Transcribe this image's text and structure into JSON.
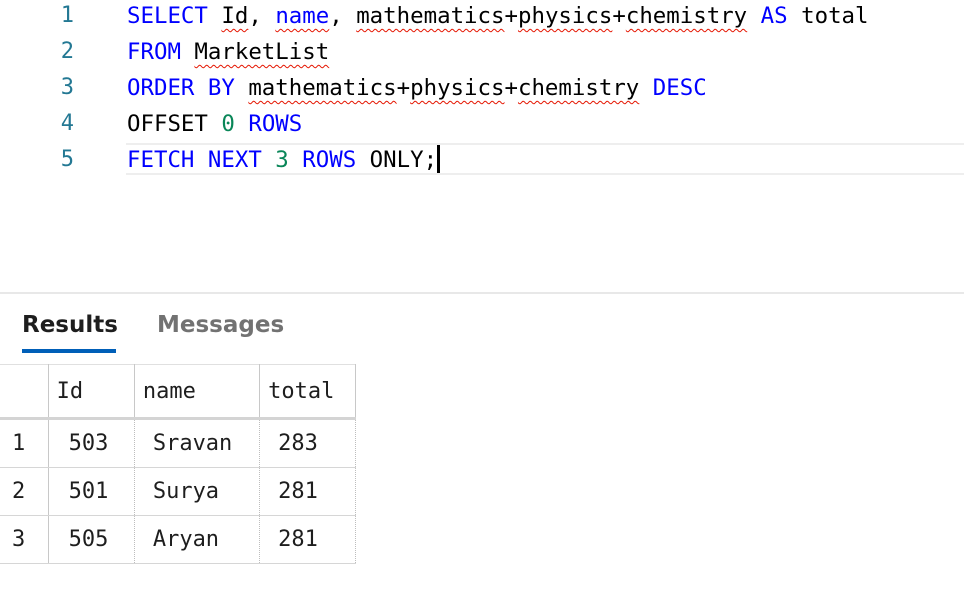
{
  "editor": {
    "lines": [
      {
        "number": "1"
      },
      {
        "number": "2"
      },
      {
        "number": "3"
      },
      {
        "number": "4"
      },
      {
        "number": "5"
      }
    ],
    "tokens": {
      "select": "SELECT",
      "id": "Id",
      "comma1": ",",
      "name": "name",
      "comma2": ",",
      "mathematics": "mathematics",
      "plus1": "+",
      "physics": "physics",
      "plus2": "+",
      "chemistry": "chemistry",
      "as": "AS",
      "total": "total",
      "from": "FROM",
      "table": "MarketList",
      "order_by": "ORDER BY",
      "mathematics2": "mathematics",
      "plus3": "+",
      "physics2": "physics",
      "plus4": "+",
      "chemistry2": "chemistry",
      "desc": "DESC",
      "offset": "OFFSET",
      "zero": "0",
      "rows1": "ROWS",
      "fetch_next": "FETCH NEXT",
      "three": "3",
      "rows2": "ROWS",
      "only": "ONLY;"
    }
  },
  "tabs": {
    "results": "Results",
    "messages": "Messages"
  },
  "grid": {
    "columns": [
      "Id",
      "name",
      "total"
    ],
    "rows": [
      {
        "rownum": "1",
        "id": "503",
        "name": "Sravan",
        "total": "283"
      },
      {
        "rownum": "2",
        "id": "501",
        "name": "Surya",
        "total": "281"
      },
      {
        "rownum": "3",
        "id": "505",
        "name": "Aryan",
        "total": "281"
      }
    ]
  },
  "colors": {
    "keyword": "#0000ff",
    "number": "#098658",
    "line_number": "#237893",
    "squiggle": "#e51400",
    "tab_accent": "#005fb8"
  }
}
